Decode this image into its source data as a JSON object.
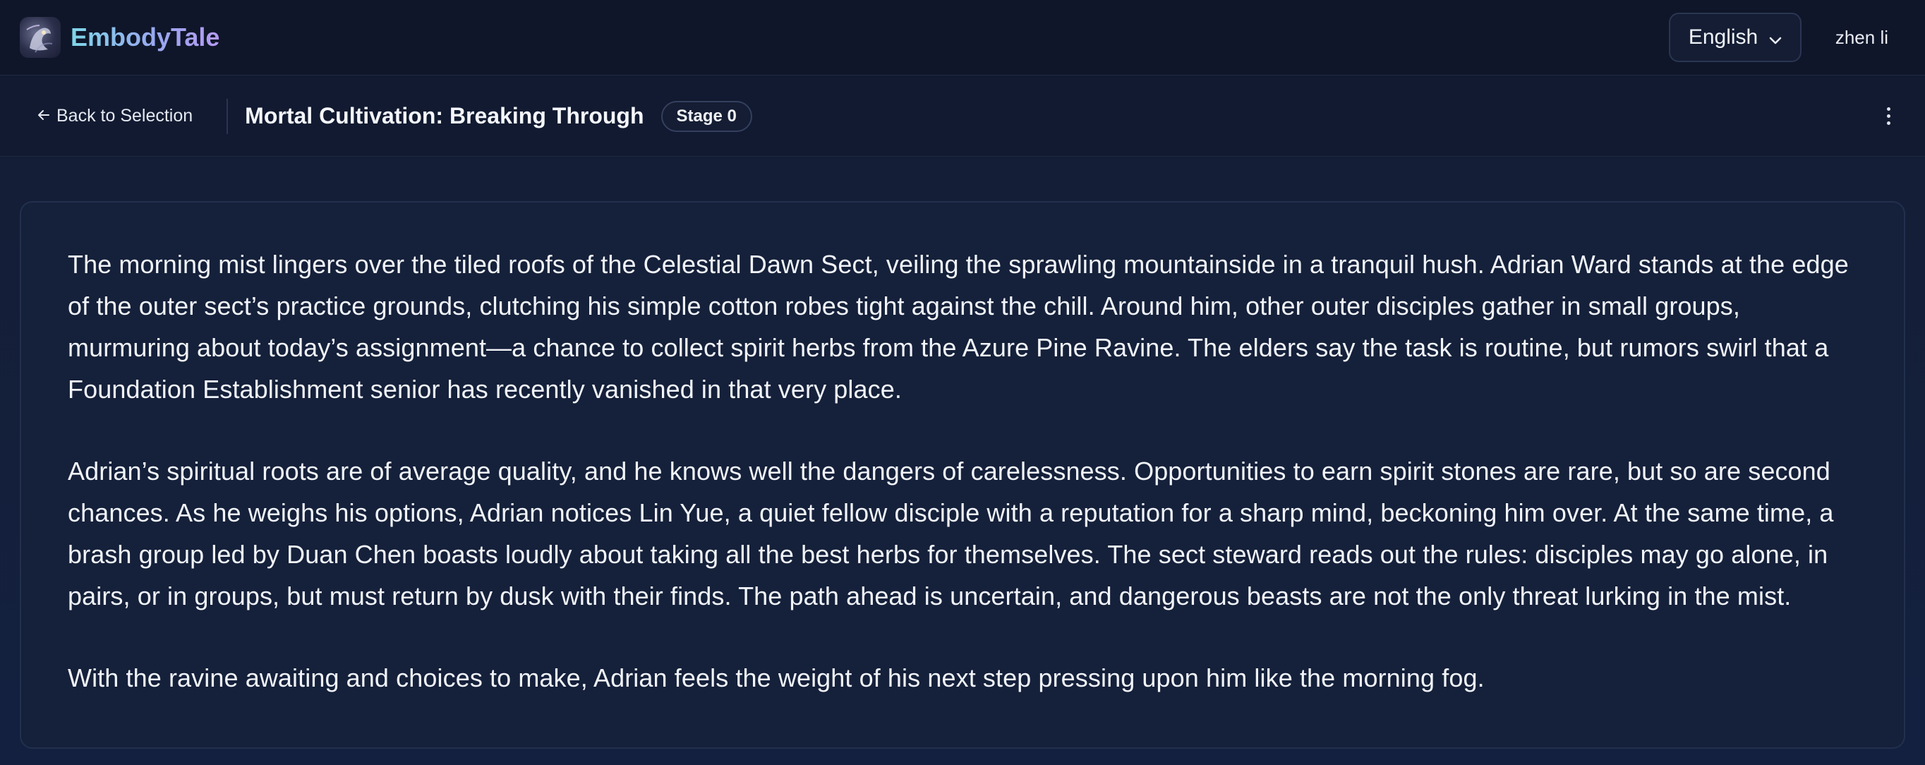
{
  "header": {
    "brand": "EmbodyTale",
    "logo_icon": "dragon-portrait-logo",
    "language": "English",
    "user_name": "zhen li"
  },
  "subheader": {
    "back_label": "Back to Selection",
    "title": "Mortal Cultivation: Breaking Through",
    "stage_badge": "Stage 0"
  },
  "story": {
    "paragraphs": [
      "The morning mist lingers over the tiled roofs of the Celestial Dawn Sect, veiling the sprawling mountainside in a tranquil hush. Adrian Ward stands at the edge of the outer sect’s practice grounds, clutching his simple cotton robes tight against the chill. Around him, other outer disciples gather in small groups, murmuring about today’s assignment—a chance to collect spirit herbs from the Azure Pine Ravine. The elders say the task is routine, but rumors swirl that a Foundation Establishment senior has recently vanished in that very place.",
      "Adrian’s spiritual roots are of average quality, and he knows well the dangers of carelessness. Opportunities to earn spirit stones are rare, but so are second chances. As he weighs his options, Adrian notices Lin Yue, a quiet fellow disciple with a reputation for a sharp mind, beckoning him over. At the same time, a brash group led by Duan Chen boasts loudly about taking all the best herbs for themselves. The sect steward reads out the rules: disciples may go alone, in pairs, or in groups, but must return by dusk with their finds. The path ahead is uncertain, and dangerous beasts are not the only threat lurking in the mist.",
      "With the ravine awaiting and choices to make, Adrian feels the weight of his next step pressing upon him like the morning fog."
    ]
  },
  "colors": {
    "background": "#111a2e",
    "card": "#15203a",
    "brand_gradient_start": "#7fd6e8",
    "brand_gradient_end": "#b59af2"
  }
}
